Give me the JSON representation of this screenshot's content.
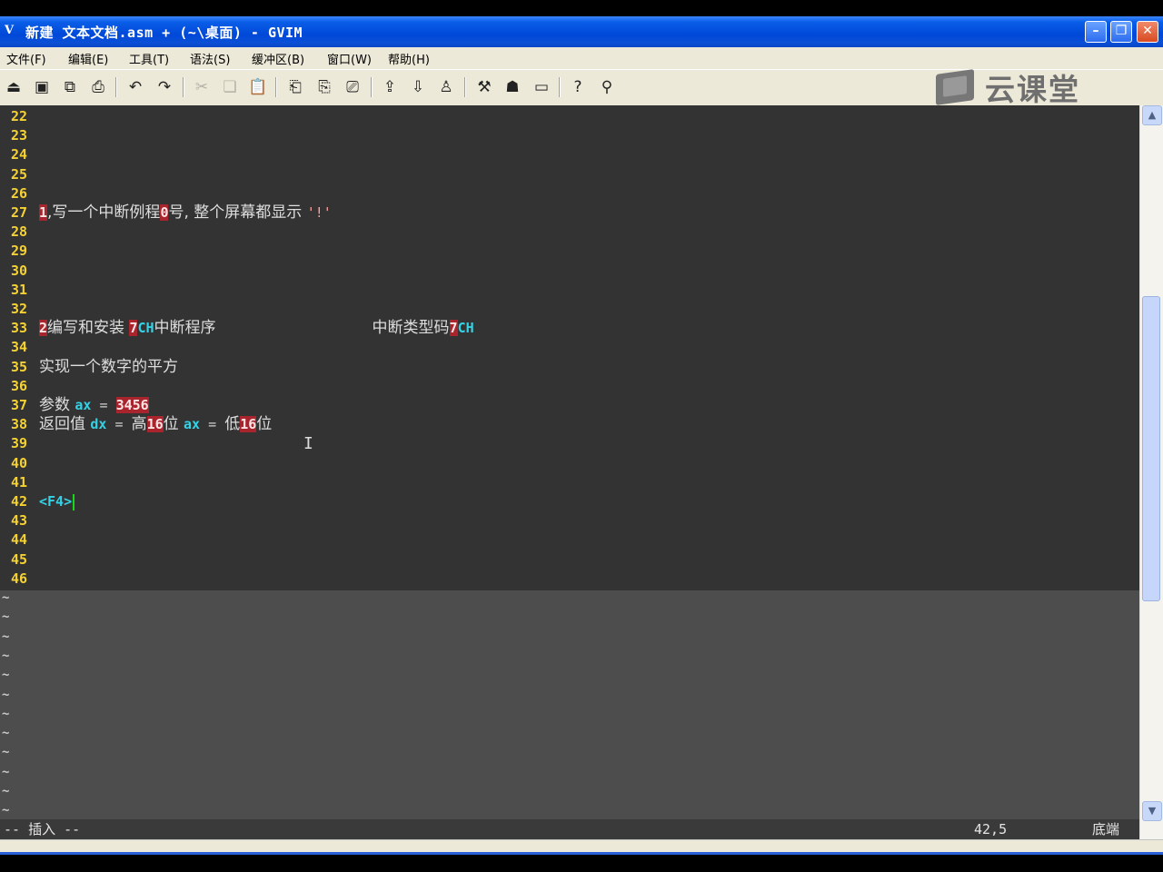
{
  "window": {
    "title": "新建 文本文档.asm + (~\\桌面) - GVIM",
    "icon": "vim-icon"
  },
  "menu": [
    "文件(F)",
    "编辑(E)",
    "工具(T)",
    "语法(S)",
    "缓冲区(B)",
    "窗口(W)",
    "帮助(H)"
  ],
  "watermark": {
    "text": "云课堂"
  },
  "editor": {
    "lines": [
      {
        "n": "22"
      },
      {
        "n": "23"
      },
      {
        "n": "24"
      },
      {
        "n": "25"
      },
      {
        "n": "26"
      },
      {
        "n": "27",
        "a": "1",
        "b": ",写一个中断例程",
        "c": "0",
        "d": "号, 整个屏幕都显示 ",
        "e": "'!'"
      },
      {
        "n": "28"
      },
      {
        "n": "29"
      },
      {
        "n": "30"
      },
      {
        "n": "31"
      },
      {
        "n": "32"
      },
      {
        "n": "33",
        "a": "2",
        "b": "编写和安装 ",
        "c": "7",
        "d": "CH",
        "e": "中断程序",
        "f": "中断类型码",
        "g": "7",
        "h": "CH"
      },
      {
        "n": "34"
      },
      {
        "n": "35",
        "b": "实现一个数字的平方"
      },
      {
        "n": "36"
      },
      {
        "n": "37",
        "b": "参数 ",
        "c": "ax",
        "d": " = ",
        "e": "3456"
      },
      {
        "n": "38",
        "b": "返回值 ",
        "c": "dx",
        "d": " = ",
        "e": "高",
        "f": "16",
        "g": "位 ",
        "h": "ax",
        "i": " = ",
        "j": "低",
        "k": "16",
        "l": "位"
      },
      {
        "n": "39"
      },
      {
        "n": "40"
      },
      {
        "n": "41"
      },
      {
        "n": "42",
        "b": "<F4>"
      },
      {
        "n": "43"
      },
      {
        "n": "44"
      },
      {
        "n": "45"
      },
      {
        "n": "46"
      }
    ],
    "tilde": "~"
  },
  "status": {
    "mode": "-- 插入 --",
    "position": "42,5",
    "scroll": "底端"
  }
}
